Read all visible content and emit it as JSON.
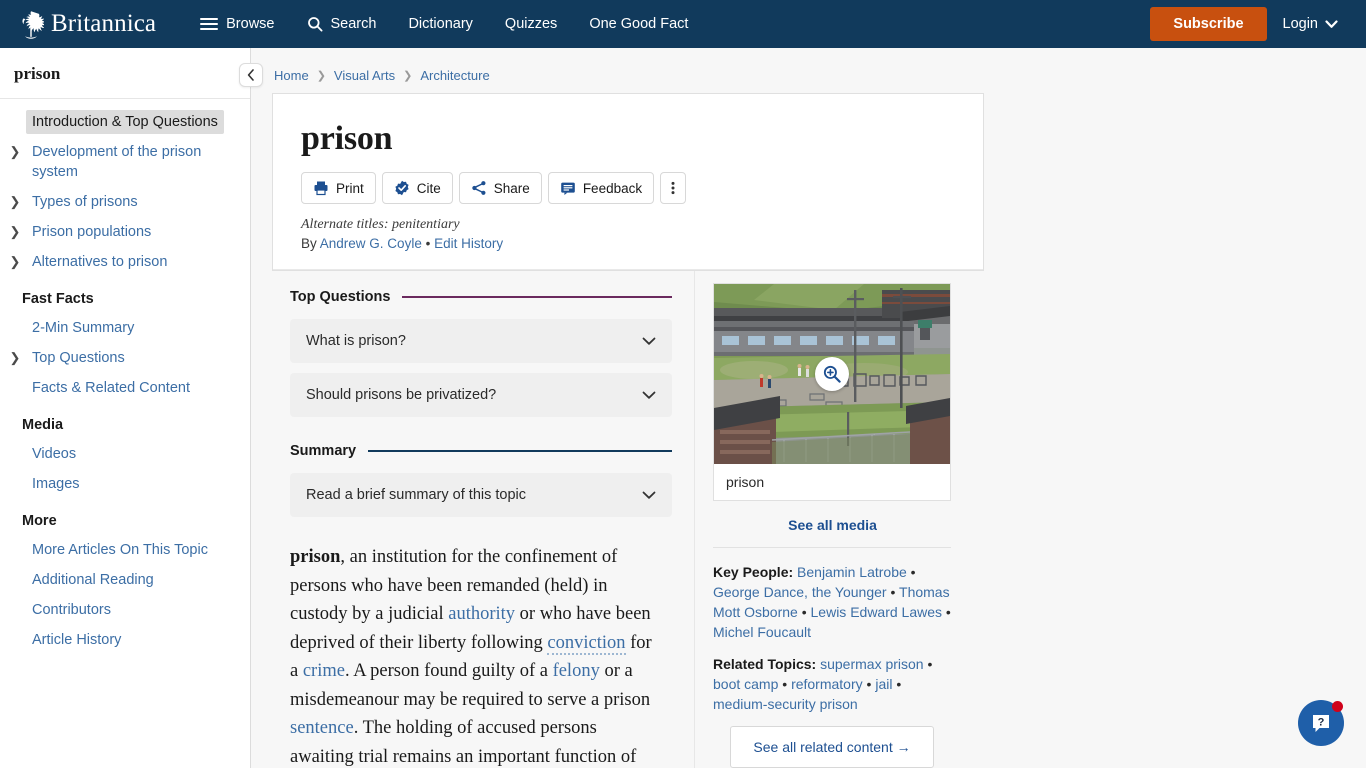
{
  "topnav": {
    "brand": "Britannica",
    "links": [
      {
        "label": "Browse",
        "icon": "hamburger-icon"
      },
      {
        "label": "Search",
        "icon": "search-icon"
      },
      {
        "label": "Dictionary",
        "icon": ""
      },
      {
        "label": "Quizzes",
        "icon": ""
      },
      {
        "label": "One Good Fact",
        "icon": ""
      }
    ],
    "subscribe": "Subscribe",
    "login": "Login",
    "colors": {
      "bar": "#113a5c",
      "subscribe": "#c8500f"
    }
  },
  "sidebar": {
    "title": "prison",
    "collapse_icon": "chevron-left-icon",
    "items": [
      {
        "label": "Introduction & Top Questions",
        "caret": false,
        "active": true
      },
      {
        "label": "Development of the prison system",
        "caret": true,
        "active": false
      },
      {
        "label": "Types of prisons",
        "caret": true,
        "active": false
      },
      {
        "label": "Prison populations",
        "caret": true,
        "active": false
      },
      {
        "label": "Alternatives to prison",
        "caret": true,
        "active": false
      }
    ],
    "groups": [
      {
        "heading": "Fast Facts",
        "items": [
          {
            "label": "2-Min Summary",
            "caret": false
          },
          {
            "label": "Top Questions",
            "caret": true
          },
          {
            "label": "Facts & Related Content",
            "caret": false
          }
        ]
      },
      {
        "heading": "Media",
        "items": [
          {
            "label": "Videos",
            "caret": false
          },
          {
            "label": "Images",
            "caret": false
          }
        ]
      },
      {
        "heading": "More",
        "items": [
          {
            "label": "More Articles On This Topic",
            "caret": false
          },
          {
            "label": "Additional Reading",
            "caret": false
          },
          {
            "label": "Contributors",
            "caret": false
          },
          {
            "label": "Article History",
            "caret": false
          }
        ]
      }
    ]
  },
  "breadcrumb": [
    "Home",
    "Visual Arts",
    "Architecture"
  ],
  "article": {
    "title": "prison",
    "tools": [
      {
        "label": "Print",
        "icon": "printer-icon"
      },
      {
        "label": "Cite",
        "icon": "badge-check-icon"
      },
      {
        "label": "Share",
        "icon": "share-icon"
      },
      {
        "label": "Feedback",
        "icon": "feedback-icon"
      },
      {
        "label": "",
        "icon": "more-vertical-icon"
      }
    ],
    "alternate_titles": "Alternate titles: penitentiary",
    "byline_prefix": "By",
    "author": "Andrew G. Coyle",
    "byline_sep": "•",
    "edit_history": "Edit History"
  },
  "sections": {
    "top_questions": {
      "heading": "Top Questions",
      "rule_color": "#6b2a5e",
      "items": [
        {
          "question": "What is prison?"
        },
        {
          "question": "Should prisons be privatized?"
        }
      ]
    },
    "summary": {
      "heading": "Summary",
      "rule_color": "#113a5c",
      "items": [
        {
          "question": "Read a brief summary of this topic"
        }
      ]
    }
  },
  "body": {
    "lead_term": "prison",
    "p1_a": ", an institution for the confinement of persons who have been remanded (held) in custody by a judicial ",
    "link_authority": "authority",
    "p1_b": " or who have been deprived of their liberty following ",
    "link_conviction": "conviction",
    "p1_c": " for a ",
    "link_crime": "crime",
    "p1_d": ". A person found guilty of a ",
    "link_felony": "felony",
    "p1_e": " or a misdemeanour may be required to serve a prison ",
    "link_sentence": "sentence",
    "p1_f": ". The holding of accused persons awaiting trial remains an important function of"
  },
  "rail": {
    "photo_caption": "prison",
    "magnifier_icon": "magnify-plus-icon",
    "see_all_media": "See all media",
    "key_people_label": "Key People:",
    "key_people": [
      "Benjamin Latrobe",
      "George Dance, the Younger",
      "Thomas Mott Osborne",
      "Lewis Edward Lawes",
      "Michel Foucault"
    ],
    "related_topics_label": "Related Topics:",
    "related_topics": [
      "supermax prison",
      "boot camp",
      "reformatory",
      "jail",
      "medium-security prison"
    ],
    "separator": "•",
    "see_all_related": "See all related content →"
  },
  "help": {
    "icon": "help-chat-icon",
    "badge": "",
    "color": "#1f5fa9"
  }
}
